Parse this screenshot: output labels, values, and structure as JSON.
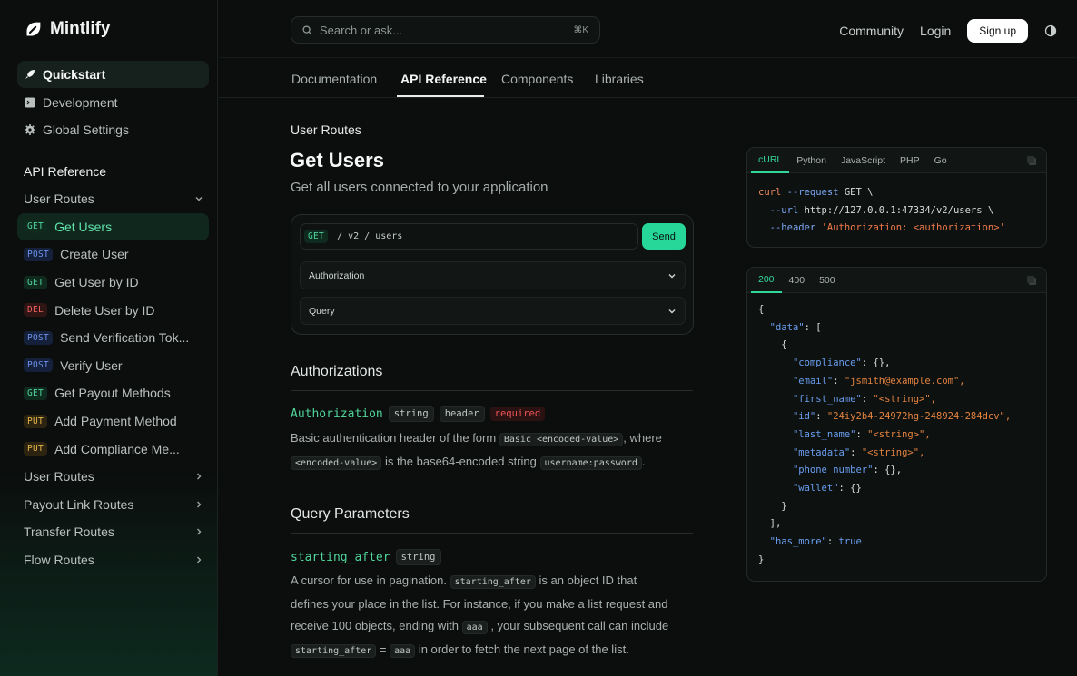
{
  "brand": {
    "name": "Mintlify"
  },
  "search": {
    "placeholder": "Search or ask...",
    "shortcut": "⌘K"
  },
  "topnav": {
    "community": "Community",
    "login": "Login",
    "signup": "Sign up"
  },
  "tabs": [
    "Documentation",
    "API Reference",
    "Components",
    "Libraries"
  ],
  "sidebar": {
    "top": [
      {
        "label": "Quickstart",
        "icon": "rocket-icon"
      },
      {
        "label": "Development",
        "icon": "terminal-icon"
      },
      {
        "label": "Global Settings",
        "icon": "gear-icon"
      }
    ],
    "section": "API Reference",
    "group": "User Routes",
    "routes": [
      {
        "method": "GET",
        "label": "Get Users"
      },
      {
        "method": "POST",
        "label": "Create User"
      },
      {
        "method": "GET",
        "label": "Get User by ID"
      },
      {
        "method": "DEL",
        "label": "Delete User by ID"
      },
      {
        "method": "POST",
        "label": "Send Verification Tok..."
      },
      {
        "method": "POST",
        "label": "Verify User"
      },
      {
        "method": "GET",
        "label": "Get Payout Methods"
      },
      {
        "method": "PUT",
        "label": "Add Payment Method"
      },
      {
        "method": "PUT",
        "label": "Add Compliance Me..."
      }
    ],
    "collapsed": [
      "User Routes",
      "Payout Link Routes",
      "Transfer Routes",
      "Flow Routes"
    ]
  },
  "main": {
    "breadcrumb": "User Routes",
    "title": "Get Users",
    "subtitle": "Get all users connected to your application",
    "playground": {
      "method": "GET",
      "path": "/  v2  /  users",
      "send": "Send",
      "authorization": "Authorization",
      "query": "Query"
    },
    "authorizations_heading": "Authorizations",
    "auth_param": {
      "name": "Authorization",
      "type": "string",
      "location": "header",
      "required": "required"
    },
    "auth_desc": {
      "p1": "Basic authentication header of the form",
      "c1": "Basic <encoded-value>",
      "p2": ", where",
      "c2": "<encoded-value>",
      "p3": "is the base64-encoded string",
      "c3": "username:password",
      "p4": "."
    },
    "query_heading": "Query Parameters",
    "query_param": {
      "name": "starting_after",
      "type": "string"
    },
    "query_desc": {
      "p1": "A cursor for use in pagination.",
      "c1": "starting_after",
      "p2": "is an object ID that defines your place in the list. For instance, if you make a list request and receive 100 objects, ending with",
      "c2": "aaa",
      "p3": ", your subsequent call can include",
      "c3": "starting_after",
      "p4": "=",
      "c4": "aaa",
      "p5": "in order to fetch the next page of the list."
    }
  },
  "request_panel": {
    "tabs": [
      "cURL",
      "Python",
      "JavaScript",
      "PHP",
      "Go"
    ],
    "line1_cmd": "curl",
    "line1_flag": "--request",
    "line1_rest": " GET \\",
    "line2_flag": "--url",
    "line2_rest": " http://127.0.0.1:47334/v2/users \\",
    "line3_flag": "--header",
    "line3_str": "'Authorization: <authorization>'"
  },
  "response_panel": {
    "tabs": [
      "200",
      "400",
      "500"
    ],
    "fields": [
      {
        "key": "\"compliance\"",
        "value": "{},"
      },
      {
        "key": "\"email\"",
        "value": "\"jsmith@example.com\","
      },
      {
        "key": "\"first_name\"",
        "value": "\"<string>\","
      },
      {
        "key": "\"id\"",
        "value": "\"24iy2b4-24972hg-248924-284dcv\","
      },
      {
        "key": "\"last_name\"",
        "value": "\"<string>\","
      },
      {
        "key": "\"metadata\"",
        "value": "\"<string>\","
      },
      {
        "key": "\"phone_number\"",
        "value": "{},"
      },
      {
        "key": "\"wallet\"",
        "value": "{}"
      }
    ],
    "data_key": "\"data\"",
    "has_more_key": "\"has_more\"",
    "has_more_value": "true"
  },
  "colors": {
    "accent": "#27d79a",
    "background": "#0b0e0d"
  }
}
